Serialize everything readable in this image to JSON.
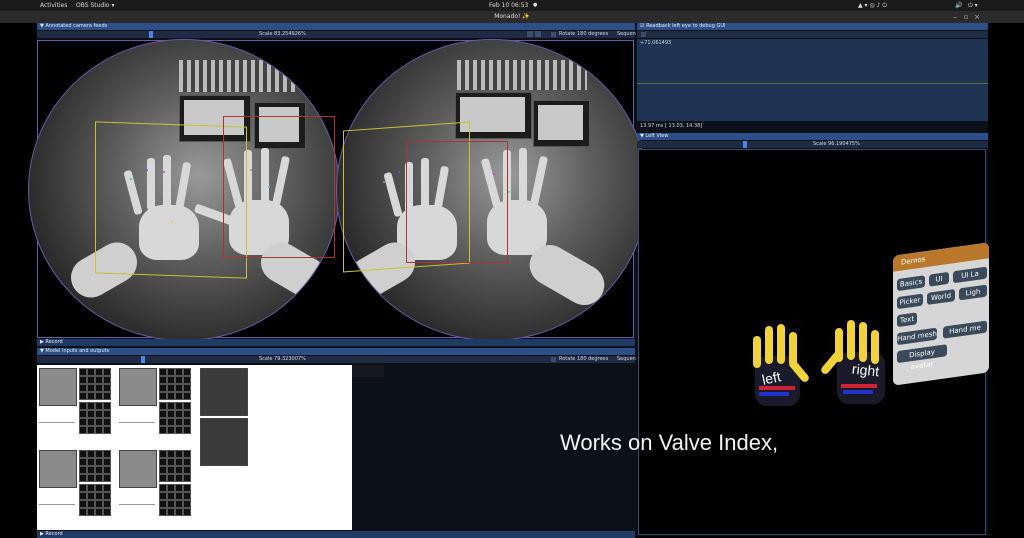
{
  "topbar": {
    "activities": "Activities",
    "app_menu": "OBS Studio ▾",
    "clock": "Feb 10 06:53",
    "dot": "●",
    "status_icons": [
      "audio-icon",
      "network-icon",
      "power-icon"
    ]
  },
  "window": {
    "title": "Monado!"
  },
  "camera_panel": {
    "header": "▼  Annotated camera feeds",
    "scale_label": "Scale 83.254926%",
    "rotate_label": "Rotate 180 degrees",
    "sequence_label": "Sequen"
  },
  "record1": {
    "header": "▶  Record"
  },
  "model_panel": {
    "header": "▼  Model inputs and outputs",
    "scale_label": "Scale 79.323007%",
    "rotate_label": "Rotate 180 degrees",
    "sequence_label": "Sequen"
  },
  "record2": {
    "header": "▶  Record"
  },
  "readback": {
    "header": "☑  Readback left eye to debug GUI",
    "value": "+71.061493",
    "footer": "13.97 ms [ 13.03,  14.38]"
  },
  "left_view": {
    "header": "▼  Left View",
    "scale_label": "Scale 96.190475%"
  },
  "vr_menu": {
    "title": "Demos",
    "buttons": [
      "Basics",
      "UI",
      "UI La",
      "Picker",
      "World",
      "Ligh",
      "Text",
      "Hand mesh",
      "Hand me",
      "Display avatar"
    ]
  },
  "gloves": {
    "left": "left",
    "right": "right"
  },
  "caption": "Works on Valve Index,",
  "colors": {
    "accent": "#2c4f87",
    "handle": "#4b86e0",
    "glove": "#f0d23a"
  }
}
